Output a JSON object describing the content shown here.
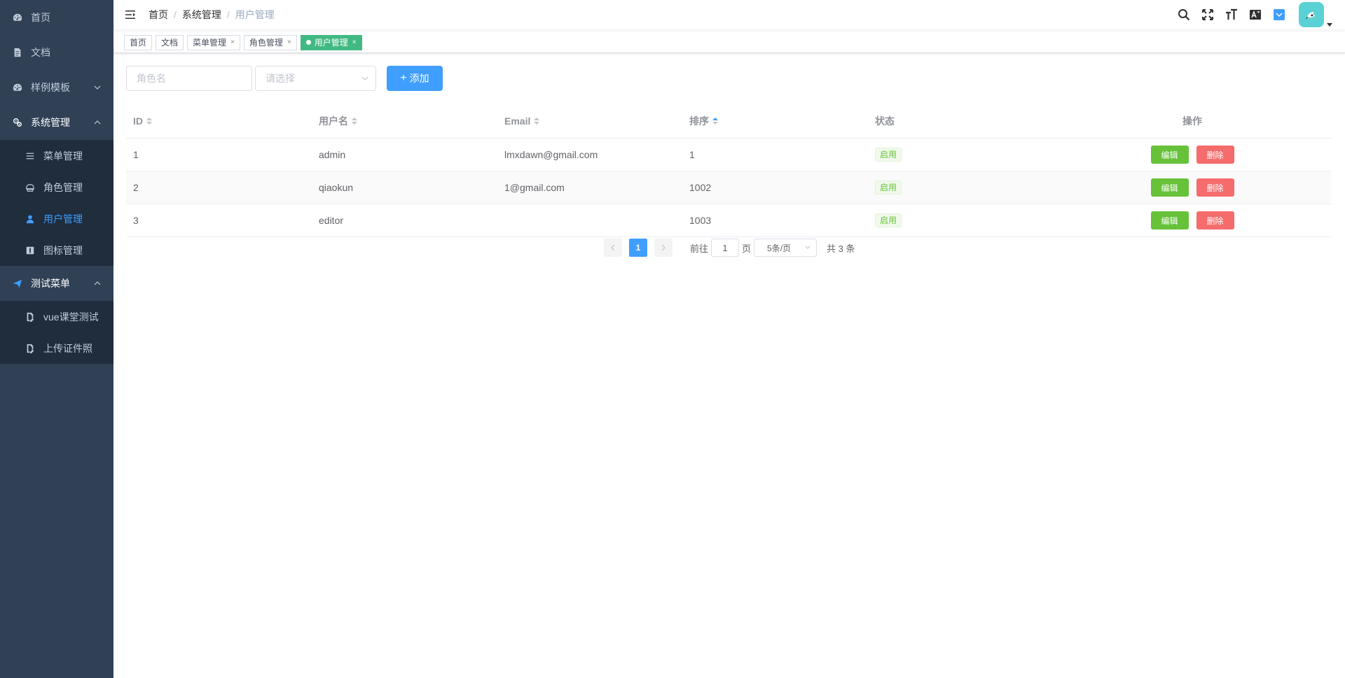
{
  "sidebar": {
    "items": [
      {
        "label": "首页",
        "icon": "dashboard-icon"
      },
      {
        "label": "文档",
        "icon": "document-icon"
      },
      {
        "label": "样例模板",
        "icon": "template-icon"
      },
      {
        "label": "系统管理",
        "icon": "settings-icon"
      },
      {
        "label": "测试菜单",
        "icon": "send-icon"
      }
    ],
    "system_sub": [
      {
        "label": "菜单管理",
        "icon": "list-icon"
      },
      {
        "label": "角色管理",
        "icon": "role-icon"
      },
      {
        "label": "用户管理",
        "icon": "user-icon"
      },
      {
        "label": "图标管理",
        "icon": "icon-manage-icon"
      }
    ],
    "test_sub": [
      {
        "label": "vue课堂测试",
        "icon": "edit-doc-icon"
      },
      {
        "label": "上传证件照",
        "icon": "edit-doc-icon"
      }
    ]
  },
  "breadcrumb": [
    "首页",
    "系统管理",
    "用户管理"
  ],
  "tags": [
    {
      "label": "首页"
    },
    {
      "label": "文档"
    },
    {
      "label": "菜单管理",
      "close": "×"
    },
    {
      "label": "角色管理",
      "close": "×"
    },
    {
      "label": "用户管理",
      "close": "×"
    }
  ],
  "filter": {
    "name_placeholder": "角色名",
    "select_placeholder": "请选择",
    "add_label": "添加",
    "add_plus": "+"
  },
  "table": {
    "headers": [
      "ID",
      "用户名",
      "Email",
      "排序",
      "状态",
      "操作"
    ],
    "rows": [
      {
        "id": "1",
        "username": "admin",
        "email": "lmxdawn@gmail.com",
        "sort": "1",
        "status": "启用"
      },
      {
        "id": "2",
        "username": "qiaokun",
        "email": "1@gmail.com",
        "sort": "1002",
        "status": "启用"
      },
      {
        "id": "3",
        "username": "editor",
        "email": "",
        "sort": "1003",
        "status": "启用"
      }
    ],
    "edit_label": "编辑",
    "delete_label": "删除"
  },
  "pagination": {
    "current": "1",
    "goto_prefix": "前往",
    "goto_value": "1",
    "goto_suffix": "页",
    "page_size": "5条/页",
    "total": "共 3 条"
  },
  "colors": {
    "sidebar_bg": "#304156",
    "submenu_bg": "#1f2d3d",
    "primary": "#409eff",
    "success": "#67c23a",
    "danger": "#f56c6c",
    "tag_active": "#42b983"
  }
}
